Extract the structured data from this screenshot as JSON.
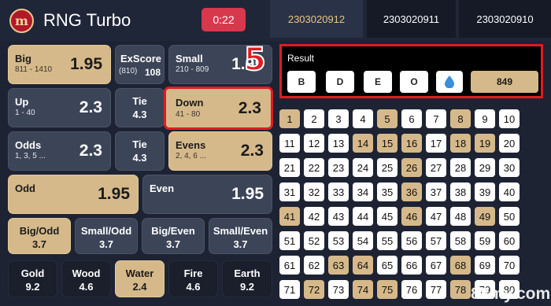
{
  "header": {
    "title": "RNG Turbo",
    "timer": "0:22",
    "logo_text": "m",
    "tabs": [
      "2303020912",
      "2303020911",
      "2303020910"
    ]
  },
  "bets": {
    "big": {
      "label": "Big",
      "range": "811 - 1410",
      "odds": "1.95"
    },
    "exscore": {
      "label": "ExScore",
      "range": "(810)",
      "odds": "108"
    },
    "small": {
      "label": "Small",
      "range": "210 - 809",
      "odds": "1.95"
    },
    "up": {
      "label": "Up",
      "range": "1 - 40",
      "odds": "2.3"
    },
    "tie1": {
      "label": "Tie",
      "odds": "4.3"
    },
    "down": {
      "label": "Down",
      "range": "41 - 80",
      "odds": "2.3"
    },
    "odds": {
      "label": "Odds",
      "range": "1, 3, 5 ...",
      "odds": "2.3"
    },
    "tie2": {
      "label": "Tie",
      "odds": "4.3"
    },
    "evens": {
      "label": "Evens",
      "range": "2, 4, 6 ...",
      "odds": "2.3"
    },
    "odd": {
      "label": "Odd",
      "odds": "1.95"
    },
    "even": {
      "label": "Even",
      "odds": "1.95"
    },
    "combos": [
      {
        "label": "Big/Odd",
        "odds": "3.7"
      },
      {
        "label": "Small/Odd",
        "odds": "3.7"
      },
      {
        "label": "Big/Even",
        "odds": "3.7"
      },
      {
        "label": "Small/Even",
        "odds": "3.7"
      }
    ],
    "elements": [
      {
        "label": "Gold",
        "odds": "9.2"
      },
      {
        "label": "Wood",
        "odds": "4.6"
      },
      {
        "label": "Water",
        "odds": "2.4"
      },
      {
        "label": "Fire",
        "odds": "4.6"
      },
      {
        "label": "Earth",
        "odds": "9.2"
      }
    ]
  },
  "result": {
    "title": "Result",
    "items": [
      "B",
      "D",
      "E",
      "O"
    ],
    "icon": "water-drop-icon",
    "total": "849"
  },
  "annotation": {
    "step": "5"
  },
  "numbers": {
    "drawn": [
      1,
      5,
      8,
      14,
      15,
      16,
      18,
      19,
      26,
      36,
      41,
      46,
      49,
      63,
      64,
      68,
      72,
      74,
      75,
      78
    ]
  },
  "watermark": "88my.com",
  "colors": {
    "gold": "#d6b98a",
    "highlight": "#e11b23"
  }
}
